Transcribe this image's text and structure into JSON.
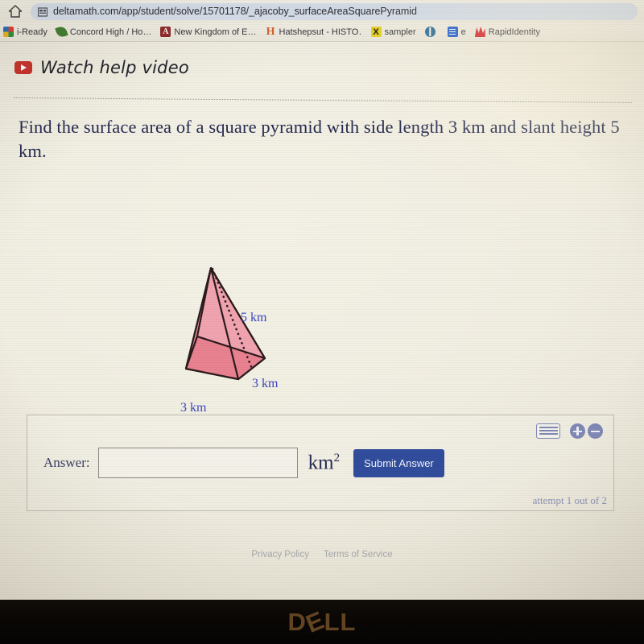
{
  "browser": {
    "home_icon": "home-icon",
    "site_icon": "site-favicon",
    "url": "deltamath.com/app/student/solve/15701178/_ajacoby_surfaceAreaSquarePyramid",
    "bookmarks": [
      {
        "label": "i-Ready",
        "icon": "iready-icon"
      },
      {
        "label": "Concord High / Ho…",
        "icon": "leaf-icon"
      },
      {
        "label": "New Kingdom of E…",
        "icon": "letter-a-icon"
      },
      {
        "label": "Hatshepsut - HISTO…",
        "icon": "letter-h-icon"
      },
      {
        "label": "sampler",
        "icon": "letter-x-icon"
      },
      {
        "label": "",
        "icon": "globe-icon"
      },
      {
        "label": "e",
        "icon": "document-icon"
      },
      {
        "label": "RapidIdentity",
        "icon": "rapididentity-icon"
      }
    ]
  },
  "page": {
    "help_video_label": "Watch help video",
    "help_video_icon": "youtube-play-icon",
    "question": "Find the surface area of a square pyramid with side length 3 km and slant height 5 km."
  },
  "figure": {
    "name": "square-pyramid-diagram",
    "fill_color": "#e8808f",
    "stroke_color": "#2a1a1c",
    "label_color": "#3b46c4",
    "slant_label": "5 km",
    "right_edge_label": "3 km",
    "bottom_edge_label": "3 km"
  },
  "answer": {
    "label": "Answer:",
    "value": "",
    "placeholder": "",
    "unit": "km",
    "unit_exponent": "2",
    "submit_label": "Submit Answer",
    "attempt_text": "attempt 1 out of 2",
    "tools": {
      "keyboard_icon": "keyboard-icon",
      "zoom_in_icon": "plus-circle-icon",
      "zoom_out_icon": "minus-circle-icon"
    }
  },
  "footer": {
    "privacy": "Privacy Policy",
    "terms": "Terms of Service"
  },
  "device": {
    "brand_d": "D",
    "brand_e": "E",
    "brand_ll": "LL"
  }
}
